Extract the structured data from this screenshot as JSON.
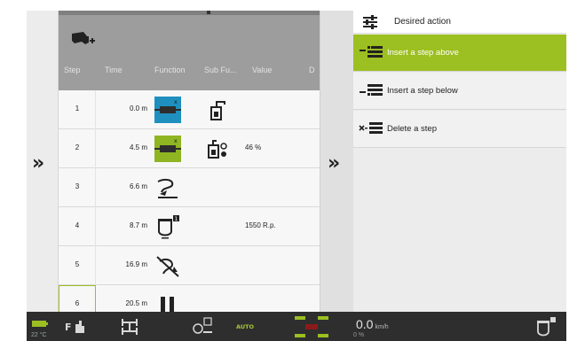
{
  "step_table": {
    "columns": [
      "Step",
      "Time",
      "Function",
      "Sub Fu...",
      "Value",
      "D"
    ],
    "rows": [
      {
        "step": "1",
        "time": "0.0 m",
        "function_icon": "hydraulic-valve-icon",
        "subfunction_icon": "valve-lever-icon",
        "value": ""
      },
      {
        "step": "2",
        "time": "4.5 m",
        "function_icon": "hydraulic-valve-green-icon",
        "subfunction_icon": "valve-flow-icon",
        "value": "46  %"
      },
      {
        "step": "3",
        "time": "6.6 m",
        "function_icon": "lift-hitch-icon",
        "subfunction_icon": "",
        "value": ""
      },
      {
        "step": "4",
        "time": "8.7 m",
        "function_icon": "engine-speed-icon",
        "subfunction_icon": "",
        "value": "1550  R.p."
      },
      {
        "step": "5",
        "time": "16.9 m",
        "function_icon": "hitch-off-icon",
        "subfunction_icon": "",
        "value": ""
      },
      {
        "step": "6",
        "time": "20.5 m",
        "function_icon": "pause-icon",
        "subfunction_icon": "",
        "value": ""
      }
    ],
    "selected_step": "6"
  },
  "action_panel": {
    "title": "Desired action",
    "items": [
      {
        "label": "Insert a step above",
        "active": true
      },
      {
        "label": "Insert a step below",
        "active": false
      },
      {
        "label": "Delete a step",
        "active": false
      }
    ]
  },
  "status_bar": {
    "temperature": "22 °C",
    "auto_label": "AUTO",
    "speed_value": "0.0",
    "speed_unit": "km/h",
    "slip": "0 %"
  },
  "colors": {
    "accent_green": "#9cbf21",
    "header_gray": "#9d9d9d",
    "status_bar": "#2e2e2e",
    "function_blue": "#1f8fc0"
  }
}
